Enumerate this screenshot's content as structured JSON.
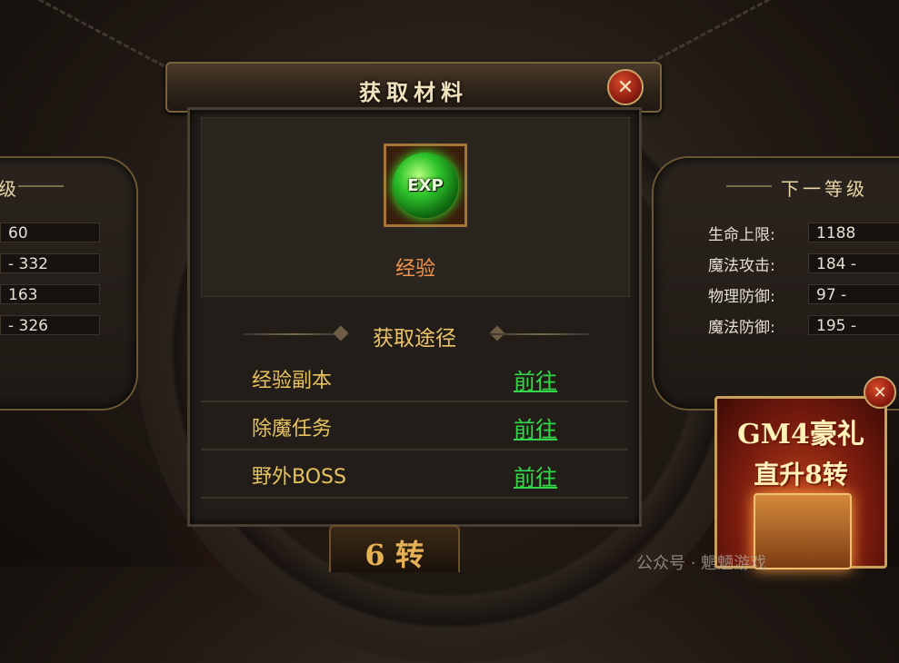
{
  "left_panel": {
    "title": "级",
    "stats": [
      "60",
      "- 332",
      "163",
      "- 326"
    ]
  },
  "right_panel": {
    "title": "下一等级",
    "stats": [
      {
        "label": "生命上限:",
        "value": "1188"
      },
      {
        "label": "魔法攻击:",
        "value": "184 -"
      },
      {
        "label": "物理防御:",
        "value": "97 -"
      },
      {
        "label": "魔法防御:",
        "value": "195 -"
      }
    ]
  },
  "dialog": {
    "title": "获取材料",
    "close_icon": "close-x-icon",
    "item": {
      "icon_text": "EXP",
      "name": "经验"
    },
    "section_title": "获取途径",
    "sources": [
      {
        "name": "经验副本",
        "action": "前往"
      },
      {
        "name": "除魔任务",
        "action": "前往"
      },
      {
        "name": "野外BOSS",
        "action": "前往"
      }
    ]
  },
  "bottom_tab": "6 转",
  "promo": {
    "line1": "GM4豪礼",
    "line2": "直升8转",
    "close_icon": "close-x-icon"
  },
  "watermark": "公众号 · 魍魉游戏",
  "colors": {
    "accent_gold": "#e9c46a",
    "link_green": "#32d84a",
    "item_name_orange": "#f2944a"
  }
}
